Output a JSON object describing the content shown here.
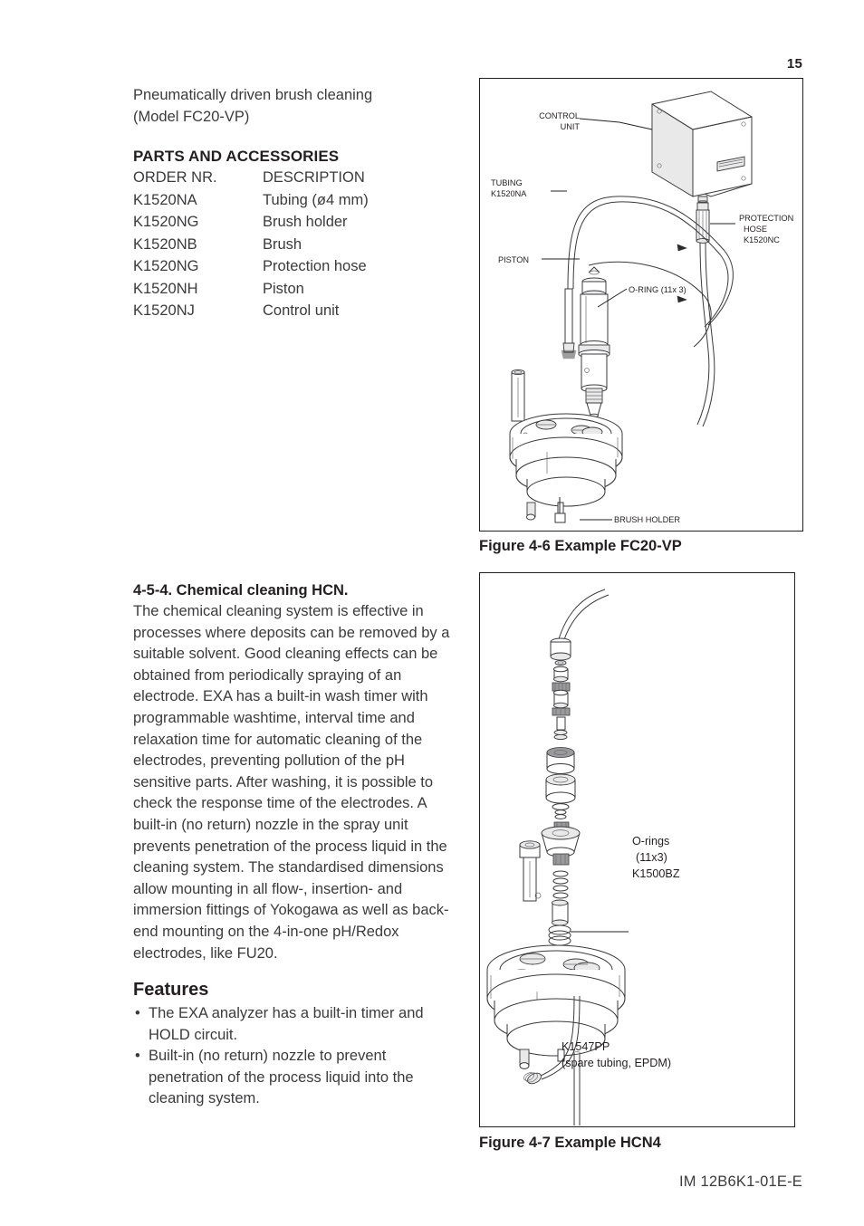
{
  "page": {
    "number": "15",
    "footer_code": "IM 12B6K1-01E-E"
  },
  "left_column": {
    "intro_line_1": "Pneumatically driven brush cleaning",
    "intro_line_2": "(Model FC20-VP)",
    "parts_heading": "PARTS AND ACCESSORIES",
    "table_header": {
      "order": "ORDER NR.",
      "description": "DESCRIPTION"
    },
    "parts": [
      {
        "order": "K1520NA",
        "description": "Tubing (ø4 mm)"
      },
      {
        "order": "K1520NG",
        "description": "Brush holder"
      },
      {
        "order": "K1520NB",
        "description": "Brush"
      },
      {
        "order": "K1520NG",
        "description": "Protection hose"
      },
      {
        "order": "K1520NH",
        "description": "Piston"
      },
      {
        "order": "K1520NJ",
        "description": "Control unit"
      }
    ]
  },
  "body_section": {
    "heading": "4-5-4. Chemical cleaning HCN.",
    "paragraph": "The chemical cleaning system is effective in processes where deposits can be removed by a suitable solvent. Good cleaning effects can be obtained from periodically spraying of an electrode. EXA has a built-in wash timer with programmable washtime, interval time and relaxation time for automatic cleaning of the electrodes, preventing pollution of the pH sensitive parts. After washing, it is possible to check the response time of the electrodes. A built-in (no return) nozzle in the spray unit prevents penetration of the process liquid in the cleaning system. The standardised dimensions allow mounting in all flow-, insertion- and immersion fittings of Yokogawa as well as back-end mounting on the 4-in-one pH/Redox electrodes, like FU20.",
    "features_heading": "Features",
    "bullet_marker": "•",
    "features": [
      "The EXA analyzer has a built-in timer and HOLD circuit.",
      "Built-in (no return) nozzle to prevent penetration of the process liquid into the cleaning system."
    ]
  },
  "figures": [
    {
      "caption": "Figure 4-6 Example FC20-VP",
      "labels": {
        "control_unit_l1": "CONTROL",
        "control_unit_l2": "UNIT",
        "protection_hose_l1": "PROTECTION",
        "protection_hose_l2": "HOSE",
        "protection_hose_l3": "K1520NC",
        "tubing_l1": "TUBING",
        "tubing_l2": "K1520NA",
        "piston": "PISTON",
        "oring": "O-RING (11x 3)",
        "brush_holder": "BRUSH HOLDER"
      }
    },
    {
      "caption": "Figure 4-7 Example HCN4",
      "labels": {
        "orings_l1": "O-rings",
        "orings_l2": "(11x3)",
        "orings_l3": "K1500BZ",
        "tubing_l1": "K1547PP",
        "tubing_l2": "(spare tubing, EPDM)"
      }
    }
  ],
  "colors": {
    "text": "#3b3b3d",
    "heading": "#231f20",
    "rule": "#231f20"
  }
}
